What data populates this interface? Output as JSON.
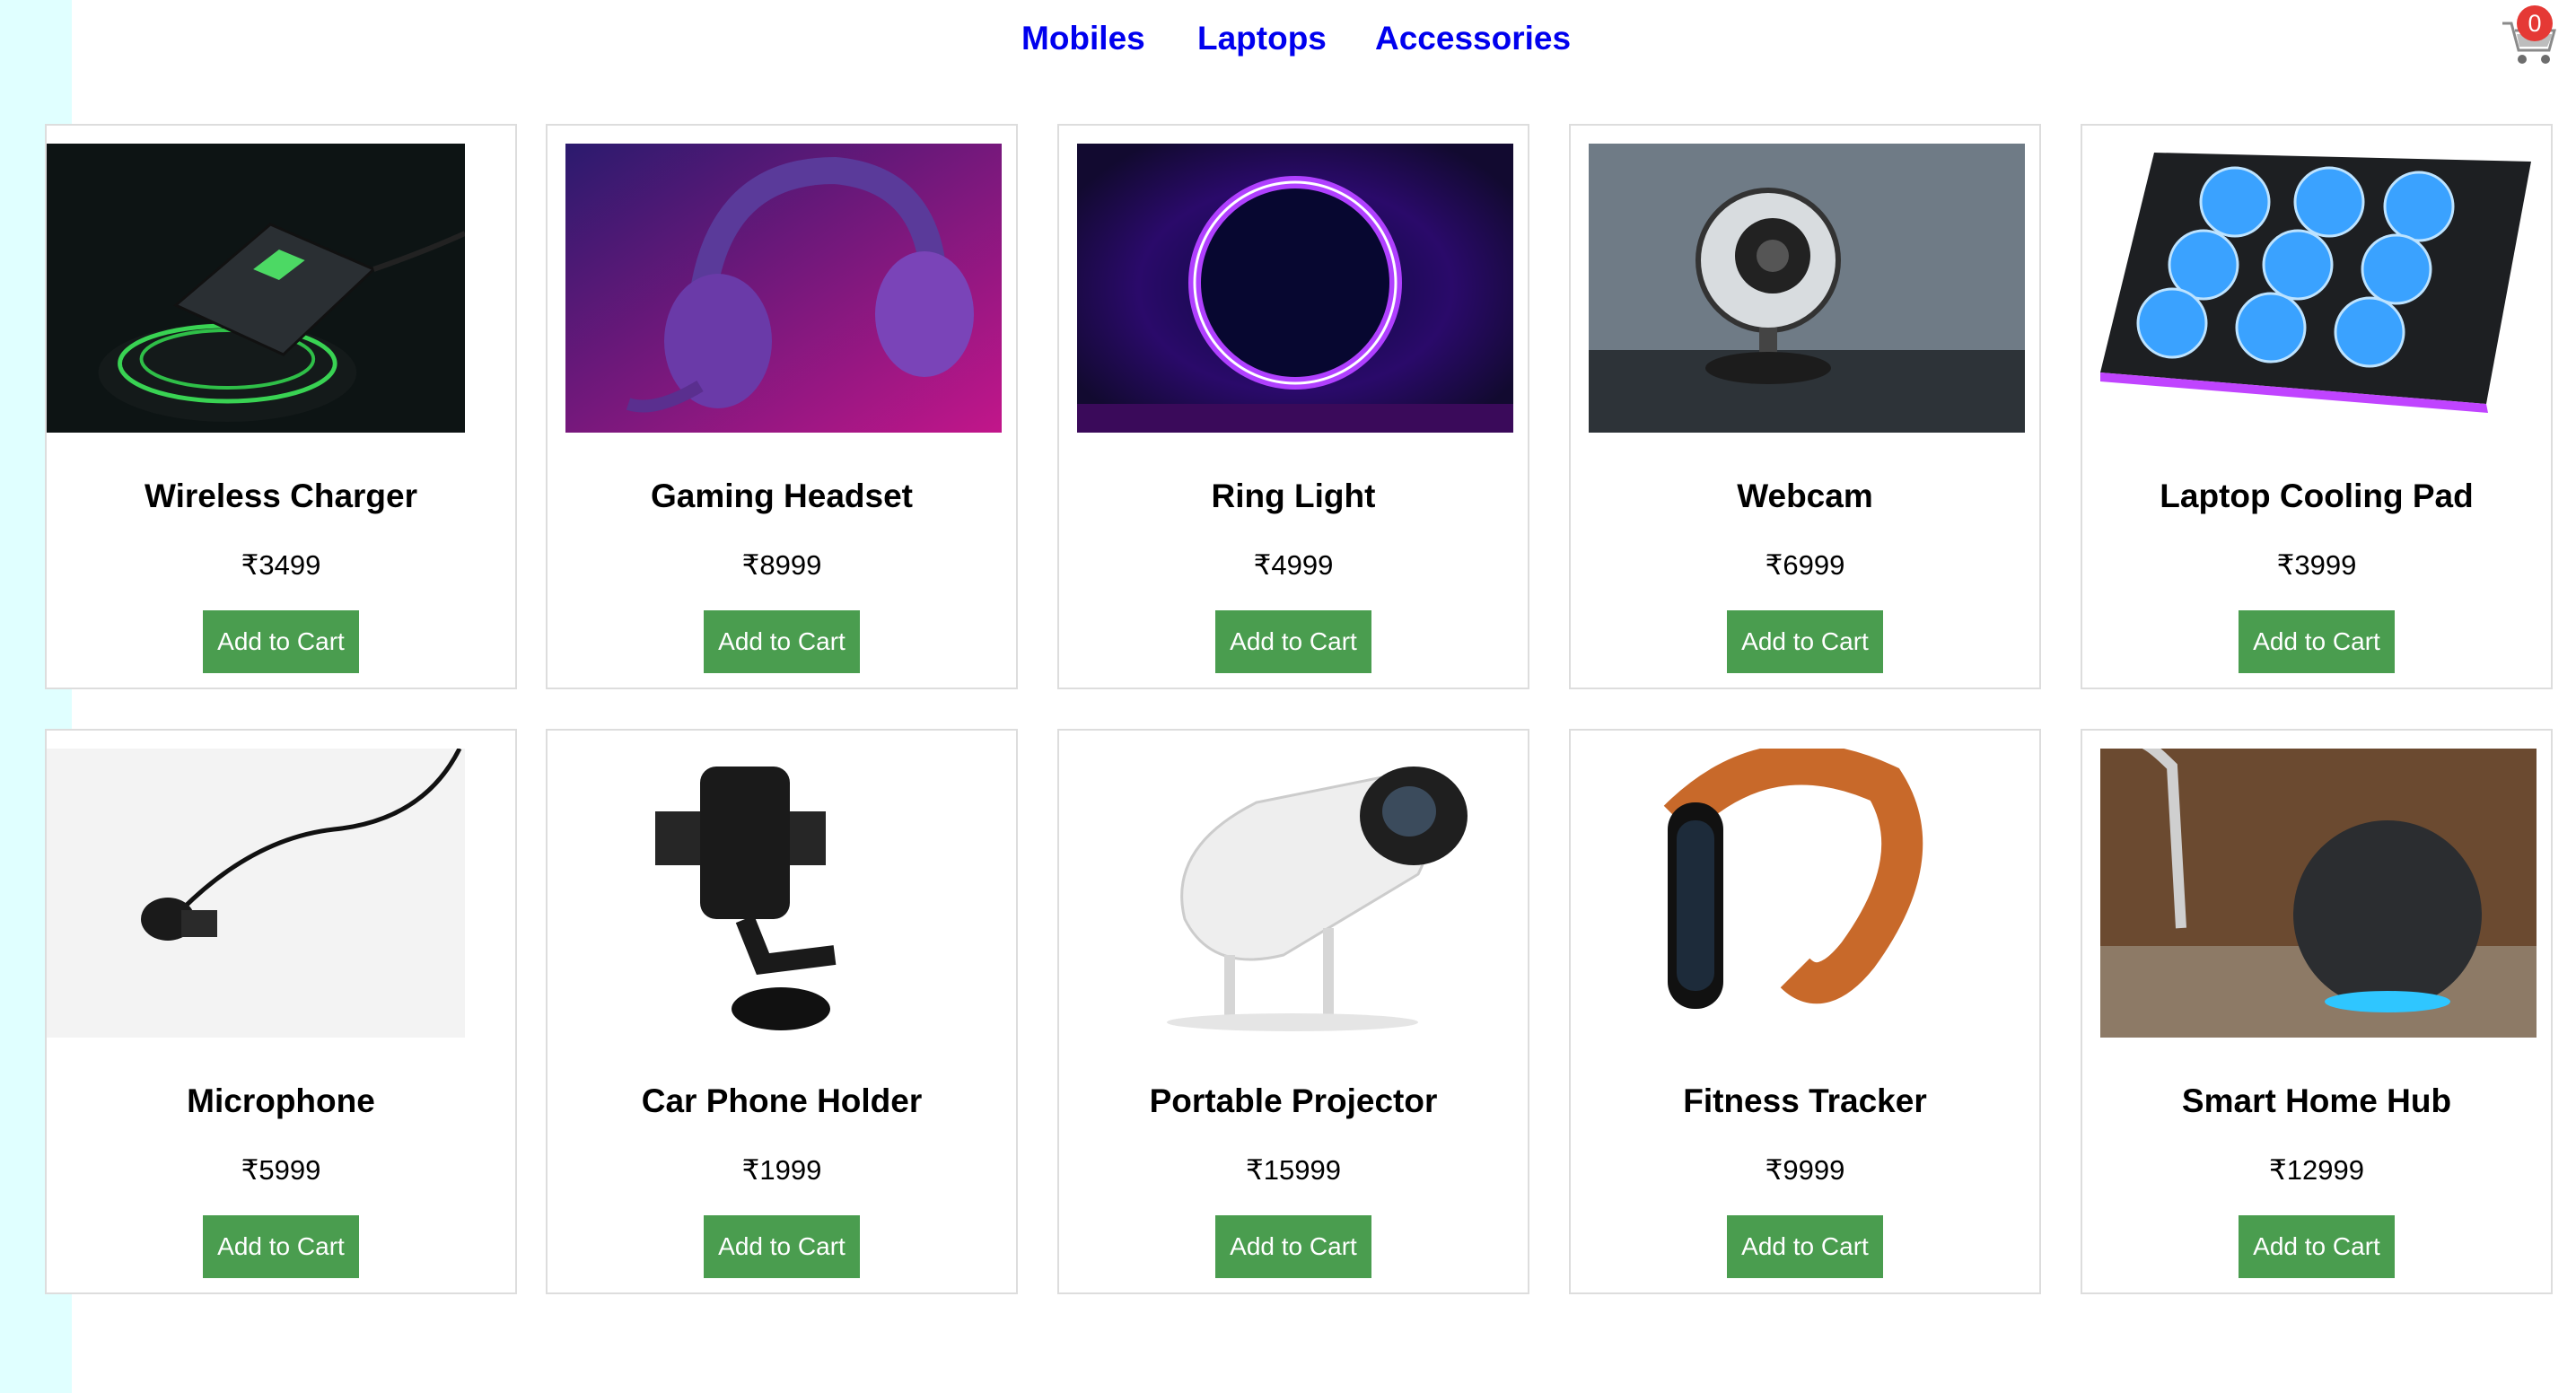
{
  "nav": {
    "items": [
      {
        "label": "Mobiles"
      },
      {
        "label": "Laptops"
      },
      {
        "label": "Accessories"
      }
    ]
  },
  "cart": {
    "count": "0",
    "icon": "shopping-cart-icon"
  },
  "products": [
    {
      "name": "Wireless Charger",
      "price": "₹3499",
      "button": "Add to Cart"
    },
    {
      "name": "Gaming Headset",
      "price": "₹8999",
      "button": "Add to Cart"
    },
    {
      "name": "Ring Light",
      "price": "₹4999",
      "button": "Add to Cart"
    },
    {
      "name": "Webcam",
      "price": "₹6999",
      "button": "Add to Cart"
    },
    {
      "name": "Laptop Cooling Pad",
      "price": "₹3999",
      "button": "Add to Cart"
    },
    {
      "name": "Microphone",
      "price": "₹5999",
      "button": "Add to Cart"
    },
    {
      "name": "Car Phone Holder",
      "price": "₹1999",
      "button": "Add to Cart"
    },
    {
      "name": "Portable Projector",
      "price": "₹15999",
      "button": "Add to Cart"
    },
    {
      "name": "Fitness Tracker",
      "price": "₹9999",
      "button": "Add to Cart"
    },
    {
      "name": "Smart Home Hub",
      "price": "₹12999",
      "button": "Add to Cart"
    }
  ],
  "colors": {
    "nav_link": "#0000ee",
    "button_bg": "#4a9d4f",
    "sidebar_strip": "#e0ffff",
    "cart_badge": "#e53935"
  }
}
